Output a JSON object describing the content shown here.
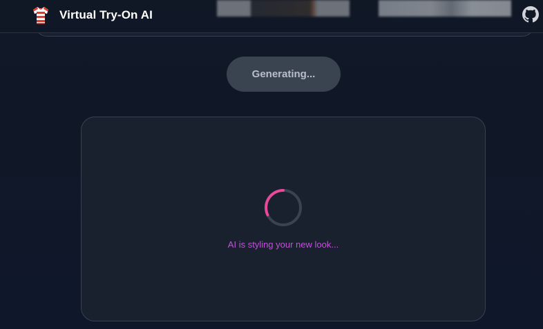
{
  "header": {
    "title": "Virtual Try-On AI",
    "logo_icon": "t-shirt-icon",
    "github_icon": "github-icon"
  },
  "actions": {
    "generate_label": "Generating..."
  },
  "result": {
    "loading_text": "AI is styling your new look...",
    "spinner_color": "#ec4899",
    "text_color": "#c054d6"
  },
  "colors": {
    "background": "#111827",
    "card": "#19212e",
    "button_disabled": "#3a4350"
  }
}
